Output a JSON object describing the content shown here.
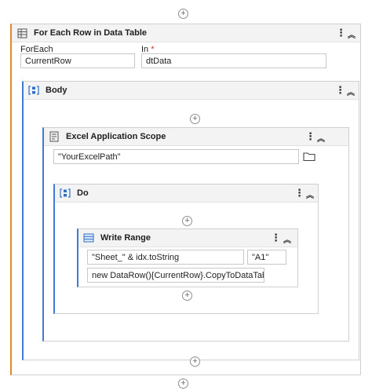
{
  "for_each": {
    "title": "For Each Row in Data Table",
    "foreach_label": "ForEach",
    "in_label": "In",
    "required_mark": "*",
    "foreach_value": "CurrentRow",
    "in_value": "dtData"
  },
  "body": {
    "title": "Body"
  },
  "excel_scope": {
    "title": "Excel Application Scope",
    "path_value": "\"YourExcelPath\""
  },
  "do": {
    "title": "Do"
  },
  "write_range": {
    "title": "Write Range",
    "sheet_value": "\"Sheet_\" & idx.toString",
    "cell_value": "\"A1\"",
    "data_value": "new DataRow(){CurrentRow}.CopyToDataTable"
  },
  "icons": {
    "add": "plus-circle-icon",
    "menu": "more-vertical-icon",
    "collapse": "double-chevron-up-icon",
    "for_each": "for-each-icon",
    "sequence": "sequence-icon",
    "excel": "document-icon",
    "write_range": "table-icon",
    "folder": "folder-icon"
  },
  "colors": {
    "accent_blue": "#3d7bd6",
    "accent_orange": "#e08a2a",
    "header_bg": "#f3f3f3"
  }
}
